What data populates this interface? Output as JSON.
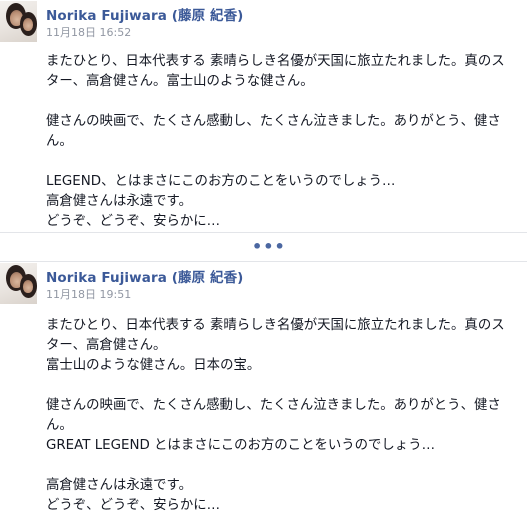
{
  "posts": [
    {
      "author": "Norika Fujiwara (藤原 紀香)",
      "timestamp": "11月18日 16:52",
      "lines": [
        "またひとり、日本代表する 素晴らしき名優が天国に旅立たれました。真のス",
        "ター、高倉健さん。富士山のような健さん。",
        "",
        "健さんの映画で、たくさん感動し、たくさん泣きました。ありがとう、健さ",
        "ん。",
        "",
        "LEGEND、とはまさにこのお方のことをいうのでしょう…",
        "高倉健さんは永遠です。",
        "どうぞ、どうぞ、安らかに…"
      ]
    },
    {
      "author": "Norika Fujiwara (藤原 紀香)",
      "timestamp": "11月18日 19:51",
      "lines": [
        "またひとり、日本代表する 素晴らしき名優が天国に旅立たれました。真のス",
        "ター、高倉健さん。",
        "富士山のような健さん。日本の宝。",
        "",
        "健さんの映画で、たくさん感動し、たくさん泣きました。ありがとう、健さ",
        "ん。",
        "GREAT LEGEND とはまさにこのお方のことをいうのでしょう…",
        "",
        "高倉健さんは永遠です。",
        "どうぞ、どうぞ、安らかに…"
      ]
    }
  ],
  "separator": {
    "more_label": "•••"
  },
  "colors": {
    "author_link": "#3b5998",
    "timestamp": "#9197a3",
    "body_text": "#141823",
    "divider": "#e3e5e9"
  },
  "icons": {
    "more": "ellipsis-icon"
  }
}
